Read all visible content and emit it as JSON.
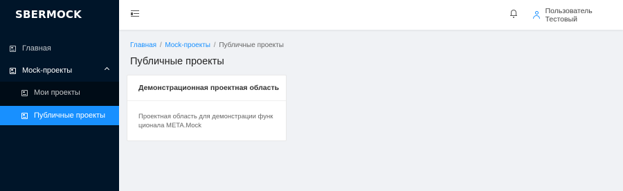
{
  "app": {
    "logo": "SBERMOCK"
  },
  "sidebar": {
    "items": [
      {
        "label": "Главная",
        "icon": "project-icon"
      },
      {
        "label": "Mock-проекты",
        "icon": "project-icon",
        "expanded": true
      },
      {
        "label": "Мои проекты",
        "icon": "project-icon"
      },
      {
        "label": "Публичные проекты",
        "icon": "project-icon",
        "selected": true
      }
    ]
  },
  "header": {
    "collapse_icon": "menu-fold-icon",
    "bell_icon": "bell-icon",
    "user_icon": "user-icon",
    "user_name": "Пользователь Тестовый"
  },
  "breadcrumb": {
    "items": [
      "Главная",
      "Mock-проекты",
      "Публичные проекты"
    ],
    "separator": "/"
  },
  "page": {
    "title": "Публичные проекты"
  },
  "cards": [
    {
      "title": "Демонстрационная проектная область",
      "description": "Проектная область для демонстрации функционала META.Mock"
    }
  ],
  "colors": {
    "sidebar_bg": "#001529",
    "submenu_bg": "#000c17",
    "accent": "#1890ff",
    "content_bg": "#f0f2f5"
  }
}
